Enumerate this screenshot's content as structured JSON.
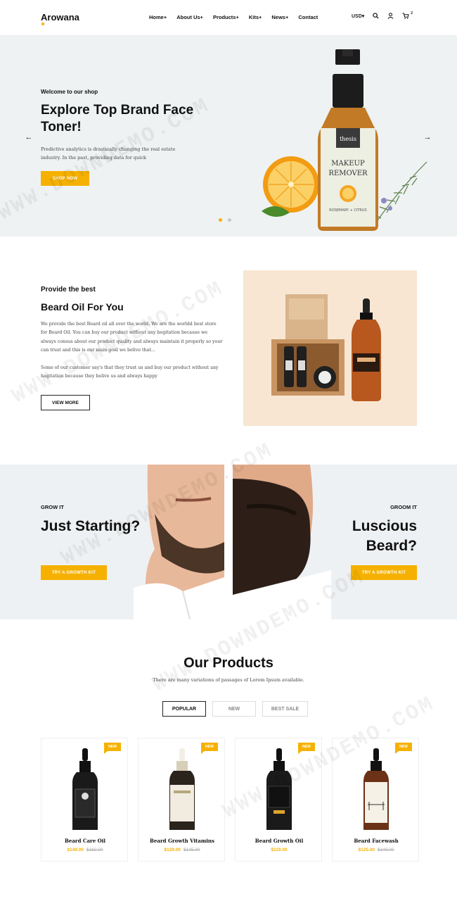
{
  "brand": {
    "name": "Arowana"
  },
  "nav": {
    "items": [
      "Home+",
      "About Us+",
      "Products+",
      "Kits+",
      "News+",
      "Contact"
    ]
  },
  "header_tools": {
    "currency": "USD",
    "cart_count": "2"
  },
  "hero": {
    "eyebrow": "Welcome to our shop",
    "title": "Explore Top Brand Face Toner!",
    "description": "Predictive analytics is drastically changing the real estate industry. In the past, providing data for quick",
    "button": "SHOP NOW",
    "bottle_label_brand": "thesis",
    "bottle_label_line1": "MAKEUP",
    "bottle_label_line2": "REMOVER",
    "bottle_label_line3": "ROSEMARY + CITRUS"
  },
  "about": {
    "eyebrow": "Provide the best",
    "title": "Beard Oil For You",
    "paragraph1": "We provide the best Beard oil all over the world. We are the worldd best store for Beard Oil. You can buy our product without any hegitation because we always consus about our product quality and always maintain it properly so your can trust and this is our main goal we belive that...",
    "paragraph2": "Some of our customer say's that they trust us and buy our product without any hagitation because they belive us and always happy",
    "button": "VIEW MORE"
  },
  "banners": [
    {
      "eyebrow": "GROW IT",
      "title": "Just Starting?",
      "button": "TRY A GROWTH KIT"
    },
    {
      "eyebrow": "GROOM IT",
      "title": "Luscious Beard?",
      "button": "TRY A GROWTH KIT"
    }
  ],
  "products": {
    "title": "Our Products",
    "subtitle": "There are many variations of passages of Lorem Ipsum available.",
    "tabs": [
      "POPULAR",
      "NEW",
      "BEST SALE"
    ],
    "items": [
      {
        "badge": "NEW",
        "name": "Beard Care Oil",
        "price": "$149.00",
        "old_price": "$162.00"
      },
      {
        "badge": "NEW",
        "name": "Beard Growth Vitamins",
        "price": "$129.00",
        "old_price": "$145.00"
      },
      {
        "badge": "NEW",
        "name": "Beard Growth Oil",
        "price": "$119.00",
        "old_price": ""
      },
      {
        "badge": "NEW",
        "name": "Beard Facewash",
        "price": "$125.00",
        "old_price": "$149.00"
      }
    ]
  },
  "watermark": "WWW.DOWNDEMO.COM",
  "colors": {
    "accent": "#f6b100",
    "hero_bg": "#eef2f3",
    "about_art_bg": "#f8e6d3"
  }
}
